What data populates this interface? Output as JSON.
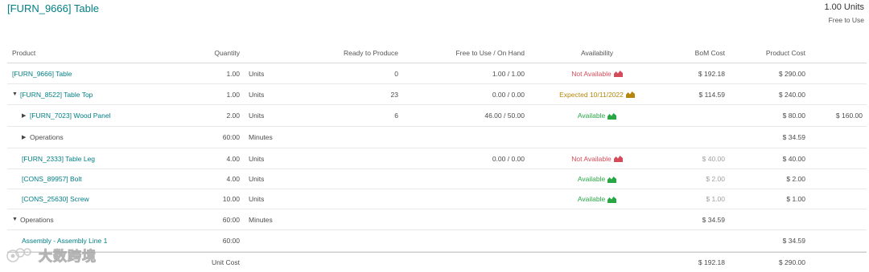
{
  "header": {
    "title": "[FURN_9666] Table",
    "units_total": "1.00 Units",
    "free_to_use_label": "Free to Use"
  },
  "columns": {
    "product": "Product",
    "quantity": "Quantity",
    "ready": "Ready to Produce",
    "free_on_hand": "Free to Use / On Hand",
    "availability": "Availability",
    "bom_cost": "BoM Cost",
    "product_cost": "Product Cost"
  },
  "rows": [
    {
      "product": "[FURN_9666] Table",
      "qty": "1.00",
      "uom": "Units",
      "ready": "0",
      "free": "1.00 / 1.00",
      "availability": "Not Available",
      "bom_cost": "$ 192.18",
      "product_cost": "$ 290.00",
      "extra": ""
    },
    {
      "product": "[FURN_8522] Table Top",
      "qty": "1.00",
      "uom": "Units",
      "ready": "23",
      "free": "0.00 / 0.00",
      "availability": "Expected 10/11/2022",
      "bom_cost": "$ 114.59",
      "product_cost": "$ 240.00",
      "extra": ""
    },
    {
      "product": "[FURN_7023] Wood Panel",
      "qty": "2.00",
      "uom": "Units",
      "ready": "6",
      "free": "46.00 / 50.00",
      "availability": "Available",
      "bom_cost": "",
      "product_cost": "$ 80.00",
      "extra": "$ 160.00"
    },
    {
      "product": "Operations",
      "qty": "60:00",
      "uom": "Minutes",
      "ready": "",
      "free": "",
      "availability": "",
      "bom_cost": "",
      "product_cost": "$ 34.59",
      "extra": ""
    },
    {
      "product": "[FURN_2333] Table Leg",
      "qty": "4.00",
      "uom": "Units",
      "ready": "",
      "free": "0.00 / 0.00",
      "availability": "Not Available",
      "bom_cost": "$ 40.00",
      "product_cost": "$ 40.00",
      "extra": ""
    },
    {
      "product": "[CONS_89957] Bolt",
      "qty": "4.00",
      "uom": "Units",
      "ready": "",
      "free": "",
      "availability": "Available",
      "bom_cost": "$ 2.00",
      "product_cost": "$ 2.00",
      "extra": ""
    },
    {
      "product": "[CONS_25630] Screw",
      "qty": "10.00",
      "uom": "Units",
      "ready": "",
      "free": "",
      "availability": "Available",
      "bom_cost": "$ 1.00",
      "product_cost": "$ 1.00",
      "extra": ""
    },
    {
      "product": "Operations",
      "qty": "60:00",
      "uom": "Minutes",
      "ready": "",
      "free": "",
      "availability": "",
      "bom_cost": "$ 34.59",
      "product_cost": "",
      "extra": ""
    },
    {
      "product": "Assembly - Assembly Line 1",
      "qty": "60:00",
      "uom": "",
      "ready": "",
      "free": "",
      "availability": "",
      "bom_cost": "",
      "product_cost": "$ 34.59",
      "extra": ""
    }
  ],
  "footer": {
    "label": "Unit Cost",
    "bom_cost": "$ 192.18",
    "product_cost": "$ 290.00"
  },
  "watermark": {
    "text": "大数跨境"
  },
  "colors": {
    "link": "#017e84",
    "not_available": "#d44c59",
    "expected": "#b5860b",
    "available": "#28a745",
    "muted": "#a0a0a0"
  },
  "icons": {
    "forecast": "area-chart-icon",
    "expand": "caret-right-icon",
    "collapse": "caret-down-icon"
  }
}
